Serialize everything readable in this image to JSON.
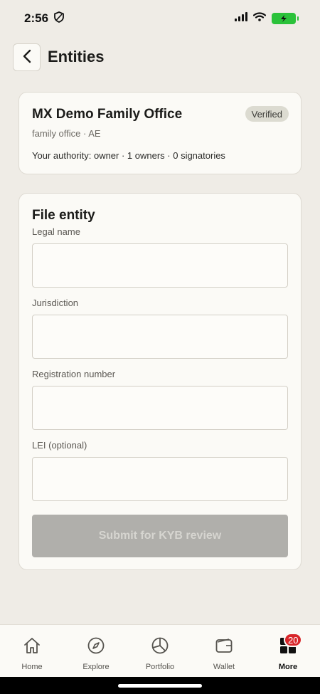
{
  "status_bar": {
    "time": "2:56"
  },
  "header": {
    "title": "Entities"
  },
  "entity_card": {
    "name": "MX Demo Family Office",
    "meta": "family office · AE",
    "badge": "Verified",
    "authority": "Your authority: owner · 1 owners · 0 signatories"
  },
  "form": {
    "title": "File entity",
    "fields": [
      {
        "label": "Legal name",
        "value": ""
      },
      {
        "label": "Jurisdiction",
        "value": ""
      },
      {
        "label": "Registration number",
        "value": ""
      },
      {
        "label": "LEI (optional)",
        "value": ""
      }
    ],
    "submit_label": "Submit for KYB review"
  },
  "tab_bar": {
    "items": [
      {
        "label": "Home",
        "icon": "home-icon"
      },
      {
        "label": "Explore",
        "icon": "compass-icon"
      },
      {
        "label": "Portfolio",
        "icon": "pie-chart-icon"
      },
      {
        "label": "Wallet",
        "icon": "wallet-icon"
      },
      {
        "label": "More",
        "icon": "grid-icon",
        "badge": "20"
      }
    ]
  },
  "colors": {
    "background": "#efece6",
    "card": "#fbfaf6",
    "badge_red": "#d8262a",
    "battery_green": "#2bc23a"
  }
}
